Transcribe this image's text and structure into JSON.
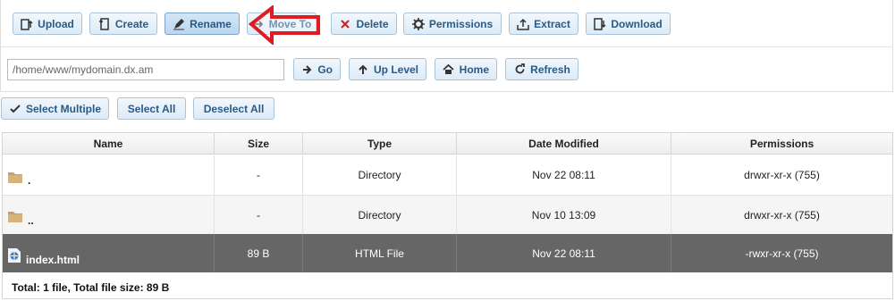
{
  "toolbar": {
    "upload": "Upload",
    "create": "Create",
    "rename": "Rename",
    "move_to": "Move To",
    "delete": "Delete",
    "permissions": "Permissions",
    "extract": "Extract",
    "download": "Download"
  },
  "nav": {
    "path": "/home/www/mydomain.dx.am",
    "go": "Go",
    "up_level": "Up Level",
    "home": "Home",
    "refresh": "Refresh"
  },
  "selection": {
    "select_multiple": "Select Multiple",
    "select_all": "Select All",
    "deselect_all": "Deselect All"
  },
  "table": {
    "columns": [
      "Name",
      "Size",
      "Type",
      "Date Modified",
      "Permissions"
    ],
    "rows": [
      {
        "name": ".",
        "size": "-",
        "type": "Directory",
        "date": "Nov 22 08:11",
        "perms": "drwxr-xr-x (755)",
        "icon": "folder-icon"
      },
      {
        "name": "..",
        "size": "-",
        "type": "Directory",
        "date": "Nov 10 13:09",
        "perms": "drwxr-xr-x (755)",
        "icon": "folder-icon"
      },
      {
        "name": "index.html",
        "size": "89 B",
        "type": "HTML File",
        "date": "Nov 22 08:11",
        "perms": "-rwxr-xr-x (755)",
        "icon": "html-file-icon",
        "selected": true
      }
    ],
    "footer": "Total: 1 file, Total file size: 89 B"
  },
  "colors": {
    "annotation_arrow": "#e11b22",
    "button_text": "#2a5a86",
    "selected_row": "#666666"
  }
}
